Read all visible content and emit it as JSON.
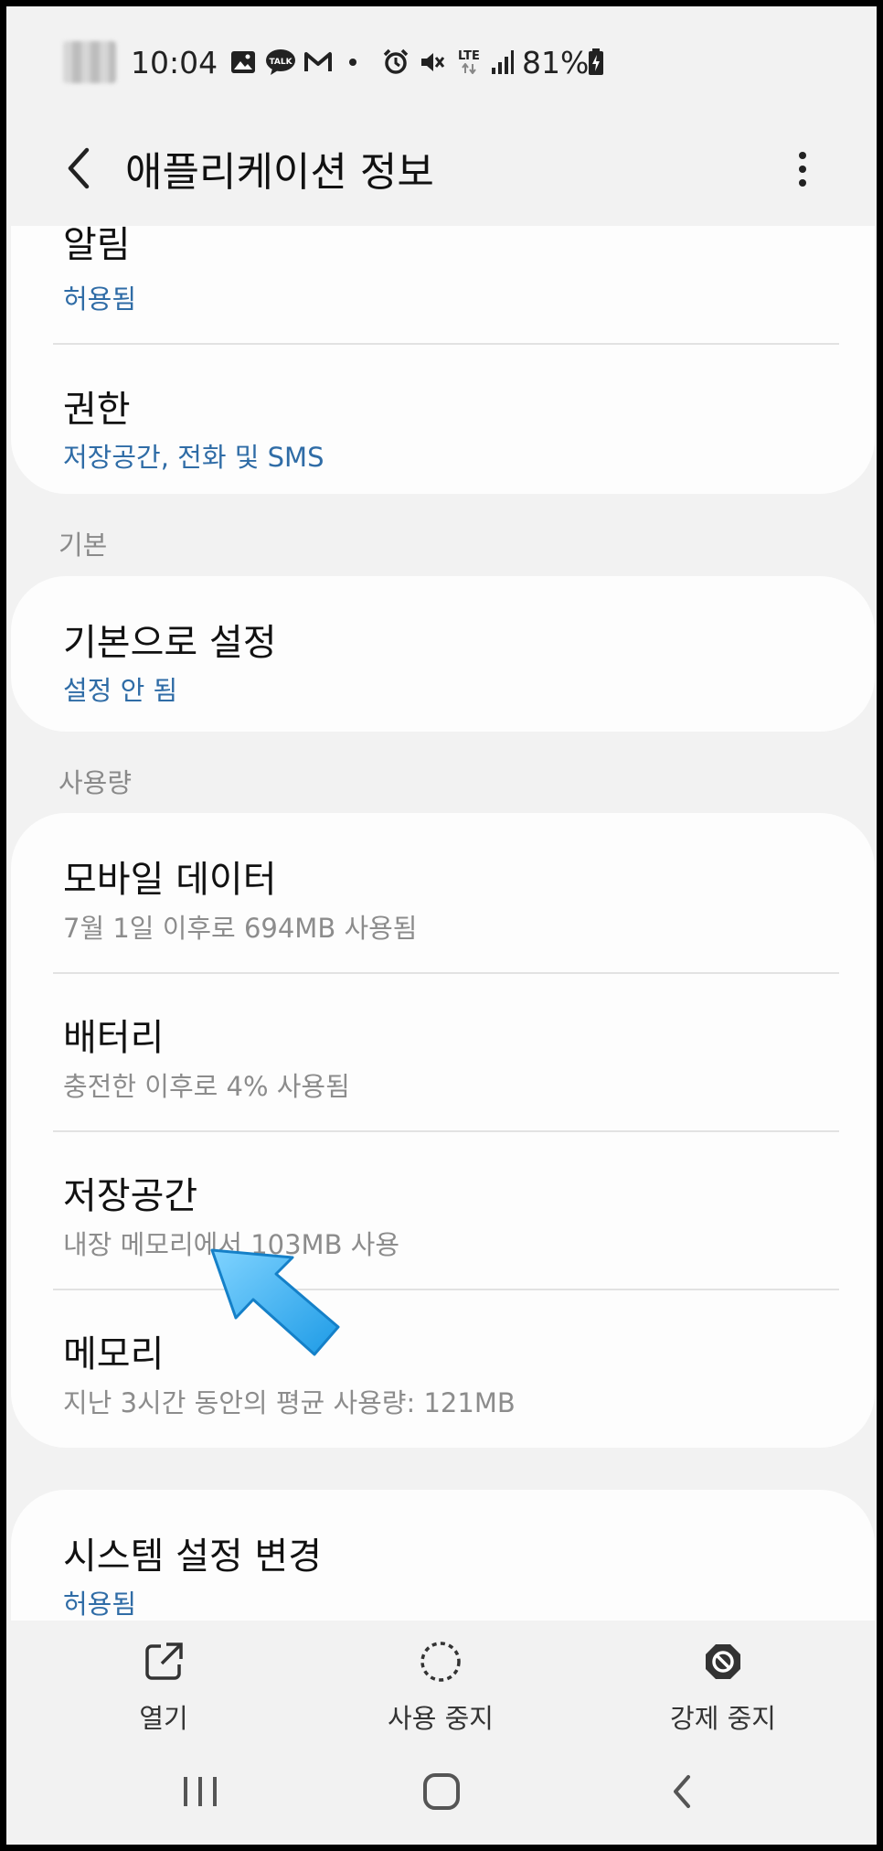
{
  "status_bar": {
    "time": "10:04",
    "network": "LTE",
    "battery": "81%",
    "icons": [
      "gallery-icon",
      "talk-icon",
      "gmail-icon",
      "dot-icon",
      "alarm-icon",
      "mute-icon",
      "lte-icon",
      "signal-icon",
      "battery-icon"
    ],
    "talk_text": "TALK"
  },
  "app_bar": {
    "title": "애플리케이션 정보",
    "back_icon": "back-arrow-icon",
    "menu_icon": "more-vert-icon"
  },
  "card_top": {
    "items": [
      {
        "title": "알림",
        "subtitle": "허용됨"
      },
      {
        "title": "권한",
        "subtitle": "저장공간, 전화 및 SMS"
      }
    ]
  },
  "section_default": {
    "header": "기본",
    "items": [
      {
        "title": "기본으로 설정",
        "subtitle": "설정 안 됨"
      }
    ]
  },
  "section_usage": {
    "header": "사용량",
    "items": [
      {
        "title": "모바일 데이터",
        "subtitle": "7월 1일 이후로 694MB 사용됨"
      },
      {
        "title": "배터리",
        "subtitle": "충전한 이후로 4% 사용됨"
      },
      {
        "title": "저장공간",
        "subtitle": "내장 메모리에서 103MB 사용"
      },
      {
        "title": "메모리",
        "subtitle": "지난 3시간 동안의 평균 사용량: 121MB"
      }
    ]
  },
  "card_system": {
    "items": [
      {
        "title": "시스템 설정 변경",
        "subtitle": "허용됨"
      }
    ]
  },
  "actions": [
    {
      "label": "열기",
      "icon": "open-external-icon"
    },
    {
      "label": "사용 중지",
      "icon": "disable-dashed-circle-icon"
    },
    {
      "label": "강제 중지",
      "icon": "force-stop-icon"
    }
  ],
  "nav": {
    "recents_icon": "recents-icon",
    "home_icon": "home-icon",
    "back_icon": "nav-back-icon"
  },
  "colors": {
    "accent_blue": "#2f6ca6",
    "annotation_arrow": "#3ab0f0",
    "background": "#f2f2f2",
    "card": "#fdfdfd"
  }
}
